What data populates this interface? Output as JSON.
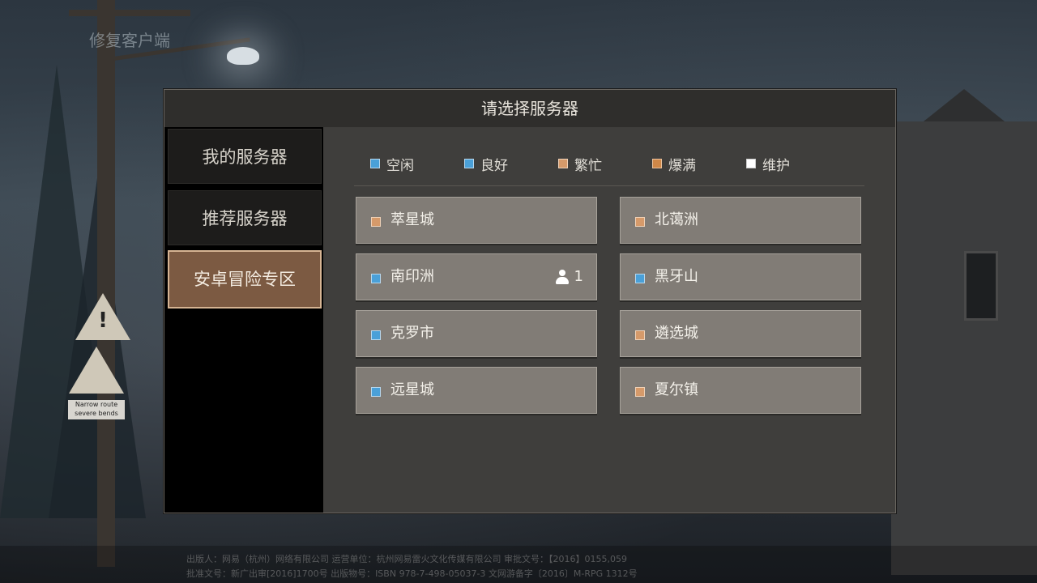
{
  "background": {
    "corner_title": "修复客户端",
    "sign_plate_text": "Narrow route\nsevere bends",
    "footer_lines": [
      "出版人：网易（杭州）网络有限公司    运营单位：杭州网易雷火文化传媒有限公司    审批文号：【2016】0155,059",
      "批准文号：新广出审[2016]1700号    出版物号：ISBN 978-7-498-05037-3    文网游备字〔2016〕M-RPG 1312号"
    ]
  },
  "dialog": {
    "title": "请选择服务器",
    "sidebar": [
      {
        "label": "我的服务器",
        "active": false
      },
      {
        "label": "推荐服务器",
        "active": false
      },
      {
        "label": "安卓冒险专区",
        "active": true
      }
    ],
    "legend": [
      {
        "label": "空闲",
        "color": "#4aa0d8"
      },
      {
        "label": "良好",
        "color": "#4aa0d8"
      },
      {
        "label": "繁忙",
        "color": "#d69a6a"
      },
      {
        "label": "爆满",
        "color": "#d08848"
      },
      {
        "label": "维护",
        "color": "#ffffff"
      }
    ],
    "servers": [
      {
        "name": "萃星城",
        "status_color": "#d69a6a",
        "count": ""
      },
      {
        "name": "北蔼洲",
        "status_color": "#d69a6a",
        "count": ""
      },
      {
        "name": "南印洲",
        "status_color": "#4aa0d8",
        "count": "1"
      },
      {
        "name": "黑牙山",
        "status_color": "#4aa0d8",
        "count": ""
      },
      {
        "name": "克罗市",
        "status_color": "#4aa0d8",
        "count": ""
      },
      {
        "name": "遴选城",
        "status_color": "#d69a6a",
        "count": ""
      },
      {
        "name": "远星城",
        "status_color": "#4aa0d8",
        "count": ""
      },
      {
        "name": "夏尔镇",
        "status_color": "#d69a6a",
        "count": ""
      }
    ]
  }
}
